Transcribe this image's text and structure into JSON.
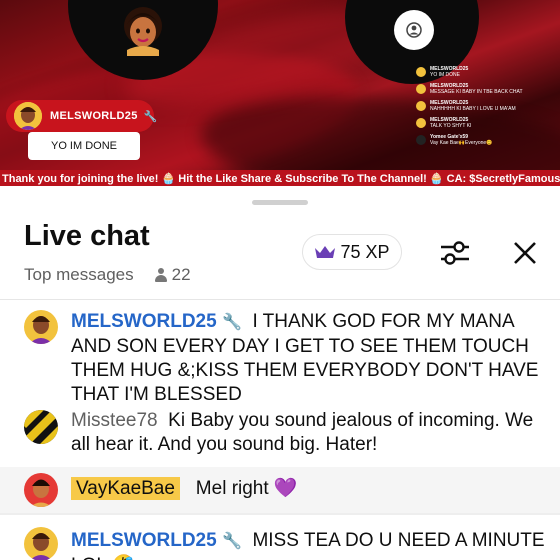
{
  "video": {
    "pinned_name": "MELSWORLD25",
    "pinned_message": "YO IM DONE",
    "mini_chat": [
      {
        "name": "MELSWORLD25",
        "text": "YO IM DONE"
      },
      {
        "name": "MELSWORLD25",
        "text": "MESSAGE KI BABY IN TBE BACK CHAT"
      },
      {
        "name": "MELSWORLD25",
        "text": "NAHHHHH KI BABY I LOVE U MA'AM"
      },
      {
        "name": "MELSWORLD25",
        "text": "TALK YO SHYT KI"
      },
      {
        "name": "Yomee Gate'x59",
        "text": "Vay Kae Bae🙌Everyone😊"
      }
    ],
    "ticker": "Thank you for joining the live! 🧁 Hit the Like Share & Subscribe To The Channel! 🧁 CA: $SecretlyFamous 🧁 Thank"
  },
  "chat": {
    "title": "Live chat",
    "mode": "Top messages",
    "viewer_count": "22",
    "xp_label": "75 XP",
    "icons": {
      "people": "people-icon",
      "crown": "crown-icon",
      "filter": "filter-sliders-icon",
      "close": "close-icon"
    },
    "colors": {
      "owner_name": "#2566c8",
      "member_badge": "#f7c948",
      "ticker_bg": "#b9121c",
      "crown": "#6a3fb5"
    },
    "messages": [
      {
        "author": "MELSWORLD25",
        "role_icon": "wrench-icon",
        "text": "I THANK GOD FOR MY MANA AND SON EVERY DAY I GET TO SEE THEM TOUCH THEM HUG &;KISS THEM EVERYBODY DON'T HAVE THAT I'M BLESSED"
      },
      {
        "author": "Misstee78",
        "text": "Ki Baby you sound jealous of incoming. We all hear it. And you sound big. Hater!"
      },
      {
        "author": "VayKaeBae",
        "text": "Mel right 💜"
      },
      {
        "author": "MELSWORLD25",
        "role_icon": "wrench-icon",
        "text": "MISS TEA DO U NEED A MINUTE LOL 🤣"
      }
    ]
  }
}
